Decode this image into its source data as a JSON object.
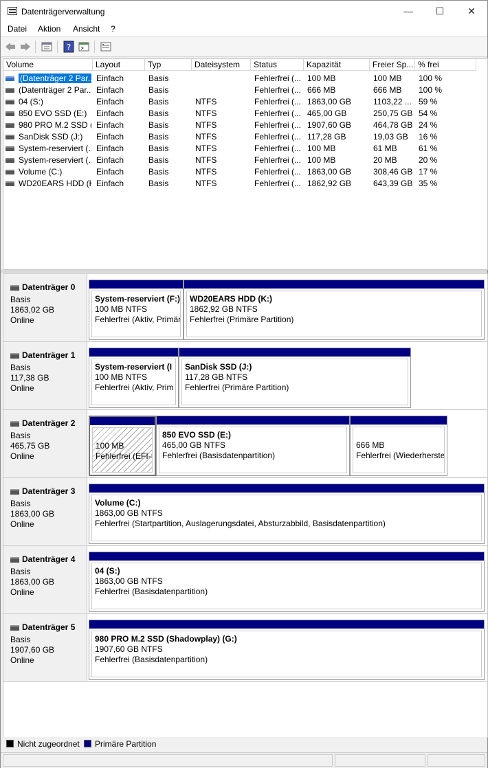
{
  "window": {
    "title": "Datenträgerverwaltung",
    "icon": "disk-management-icon",
    "controls": {
      "minimize": "—",
      "maximize": "☐",
      "close": "✕"
    }
  },
  "menu": [
    "Datei",
    "Aktion",
    "Ansicht",
    "?"
  ],
  "toolbar": [
    "back-icon",
    "forward-icon",
    "properties-icon",
    "help-icon",
    "console-icon",
    "settings-icon"
  ],
  "volume_list": {
    "columns": [
      "Volume",
      "Layout",
      "Typ",
      "Dateisystem",
      "Status",
      "Kapazität",
      "Freier Sp...",
      "% frei"
    ],
    "rows": [
      [
        "(Datenträger 2 Par...",
        "Einfach",
        "Basis",
        "",
        "Fehlerfrei (...",
        "100 MB",
        "100 MB",
        "100 %"
      ],
      [
        "(Datenträger 2 Par...",
        "Einfach",
        "Basis",
        "",
        "Fehlerfrei (...",
        "666 MB",
        "666 MB",
        "100 %"
      ],
      [
        "04 (S:)",
        "Einfach",
        "Basis",
        "NTFS",
        "Fehlerfrei (...",
        "1863,00 GB",
        "1103,22 ...",
        "59 %"
      ],
      [
        "850 EVO SSD (E:)",
        "Einfach",
        "Basis",
        "NTFS",
        "Fehlerfrei (...",
        "465,00 GB",
        "250,75 GB",
        "54 %"
      ],
      [
        "980 PRO M.2 SSD (...",
        "Einfach",
        "Basis",
        "NTFS",
        "Fehlerfrei (...",
        "1907,60 GB",
        "464,78 GB",
        "24 %"
      ],
      [
        "SanDisk SSD (J:)",
        "Einfach",
        "Basis",
        "NTFS",
        "Fehlerfrei (...",
        "117,28 GB",
        "19,03 GB",
        "16 %"
      ],
      [
        "System-reserviert (...",
        "Einfach",
        "Basis",
        "NTFS",
        "Fehlerfrei (...",
        "100 MB",
        "61 MB",
        "61 %"
      ],
      [
        "System-reserviert (...",
        "Einfach",
        "Basis",
        "NTFS",
        "Fehlerfrei (...",
        "100 MB",
        "20 MB",
        "20 %"
      ],
      [
        "Volume (C:)",
        "Einfach",
        "Basis",
        "NTFS",
        "Fehlerfrei (...",
        "1863,00 GB",
        "308,46 GB",
        "17 %"
      ],
      [
        "WD20EARS HDD (K:)",
        "Einfach",
        "Basis",
        "NTFS",
        "Fehlerfrei (...",
        "1862,92 GB",
        "643,39 GB",
        "35 %"
      ]
    ]
  },
  "disks": [
    {
      "name": "Datenträger 0",
      "type": "Basis",
      "size": "1863,02 GB",
      "status": "Online",
      "partitions": [
        {
          "name": "System-reserviert  (F:)",
          "size": "100 MB NTFS",
          "status": "Fehlerfrei (Aktiv, Primär"
        },
        {
          "name": "WD20EARS HDD  (K:)",
          "size": "1862,92 GB NTFS",
          "status": "Fehlerfrei (Primäre Partition)"
        }
      ]
    },
    {
      "name": "Datenträger 1",
      "type": "Basis",
      "size": "117,38 GB",
      "status": "Online",
      "partitions": [
        {
          "name": "System-reserviert  (I",
          "size": "100 MB NTFS",
          "status": "Fehlerfrei (Aktiv, Prim"
        },
        {
          "name": "SanDisk SSD  (J:)",
          "size": "117,28 GB NTFS",
          "status": "Fehlerfrei (Primäre Partition)"
        }
      ]
    },
    {
      "name": "Datenträger 2",
      "type": "Basis",
      "size": "465,75 GB",
      "status": "Online",
      "partitions": [
        {
          "name": "",
          "size": "100 MB",
          "status": "Fehlerfrei (EFI-S"
        },
        {
          "name": "850 EVO SSD  (E:)",
          "size": "465,00 GB NTFS",
          "status": "Fehlerfrei (Basisdatenpartition)"
        },
        {
          "name": "",
          "size": "666 MB",
          "status": "Fehlerfrei (Wiederherste"
        }
      ]
    },
    {
      "name": "Datenträger 3",
      "type": "Basis",
      "size": "1863,00 GB",
      "status": "Online",
      "partitions": [
        {
          "name": "Volume  (C:)",
          "size": "1863,00 GB NTFS",
          "status": "Fehlerfrei (Startpartition, Auslagerungsdatei, Absturzabbild, Basisdatenpartition)"
        }
      ]
    },
    {
      "name": "Datenträger 4",
      "type": "Basis",
      "size": "1863,00 GB",
      "status": "Online",
      "partitions": [
        {
          "name": "04  (S:)",
          "size": "1863,00 GB NTFS",
          "status": "Fehlerfrei (Basisdatenpartition)"
        }
      ]
    },
    {
      "name": "Datenträger 5",
      "type": "Basis",
      "size": "1907,60 GB",
      "status": "Online",
      "partitions": [
        {
          "name": "980 PRO M.2 SSD (Shadowplay)  (G:)",
          "size": "1907,60 GB NTFS",
          "status": "Fehlerfrei (Basisdatenpartition)"
        }
      ]
    }
  ],
  "legend": [
    {
      "label": "Nicht zugeordnet",
      "color": "#000000"
    },
    {
      "label": "Primäre Partition",
      "color": "#000080"
    }
  ]
}
